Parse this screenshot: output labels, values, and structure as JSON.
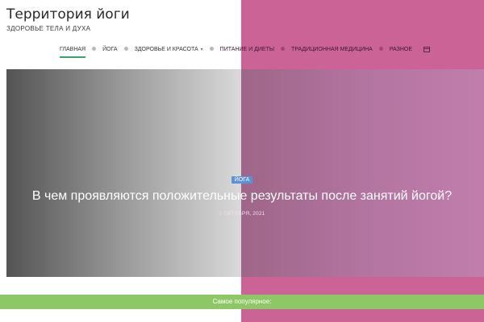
{
  "site": {
    "title": "Территория йоги",
    "tagline": "ЗДОРОВЬЕ ТЕЛА И ДУХА"
  },
  "nav": {
    "items": [
      {
        "label": "ГЛАВНАЯ"
      },
      {
        "label": "ЙОГА"
      },
      {
        "label": "ЗДОРОВЬЕ И КРАСОТА"
      },
      {
        "label": "ПИТАНИЕ И ДИЕТЫ"
      },
      {
        "label": "ТРАДИЦИОННАЯ МЕДИЦИНА"
      },
      {
        "label": "РАЗНОЕ"
      }
    ],
    "dropdown_glyph": "▾",
    "extra_icon": "calendar-icon"
  },
  "hero": {
    "category": "ЙОГА",
    "title": "В чем проявляются положительные результаты после занятий йогой?",
    "date": "1 ОКТЯБРЯ, 2021"
  },
  "popular": {
    "label": "Самое популярное:"
  },
  "colors": {
    "accent_pink": "#cc6397",
    "popular_green": "#8ec765",
    "badge_blue": "#5b91d6",
    "active_underline": "#3aa36d"
  }
}
